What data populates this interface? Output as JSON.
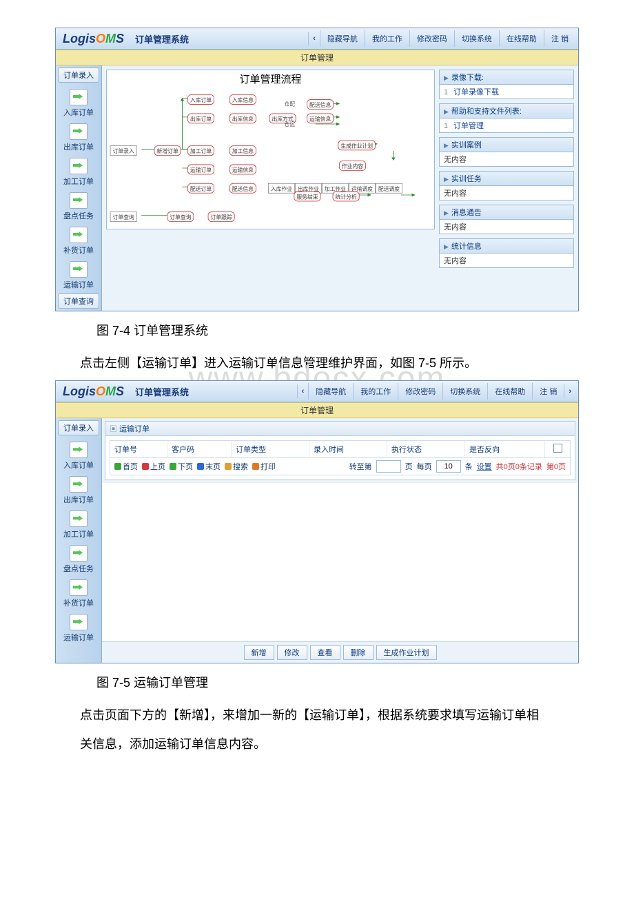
{
  "doc": {
    "caption1": "图 7-4 订单管理系统",
    "para1": "点击左侧【运输订单】进入运输订单信息管理维护界面，如图 7-5 所示。",
    "caption2": "图 7-5 运输订单管理",
    "para2": "点击页面下方的【新增】，来增加一新的【运输订单】，根据系统要求填写运输订单相",
    "para3": "关信息，添加运输订单信息内容。",
    "watermark": "www.bdocx.com"
  },
  "app": {
    "logo": {
      "p1": "Logis ",
      "p2": "O",
      "p3": "M",
      "p4": "S"
    },
    "system_title": "订单管理系统",
    "topnav": {
      "arrow_left": "‹",
      "hide_nav": "隐藏导航",
      "my_work": "我的工作",
      "change_pw": "修改密码",
      "switch_sys": "切换系统",
      "online_help": "在线帮助",
      "logout": "注    销",
      "arrow_right": "›"
    },
    "subbar": "订单管理",
    "sidebar": {
      "tab_input": "订单录入",
      "items": [
        "入库订单",
        "出库订单",
        "加工订单",
        "盘点任务",
        "补货订单",
        "运输订单"
      ],
      "tab_query": "订单查询"
    }
  },
  "flow": {
    "title": "订单管理流程",
    "order_input": "订单录入",
    "new_order": "新增订单",
    "in_order": "入库订单",
    "in_info": "入库信息",
    "out_order": "出库订单",
    "out_info": "出库信息",
    "out_way": "出库方式",
    "proc_order": "加工订单",
    "proc_info": "加工信息",
    "trans_order": "运输订单",
    "trans_info": "运输信息",
    "dist_order": "配送订单",
    "dist_info": "配送信息",
    "cang_pei": "仓配",
    "dist_route": "配送信息",
    "cang_yun": "仓运",
    "yun_info": "运输信息",
    "gen_plan": "生成作业计划",
    "job_content": "作业内容",
    "in_job": "入库作业",
    "out_job": "出库作业",
    "proc_job": "加工作业",
    "trans_sched": "运输调度",
    "dist_sched": "配送调度",
    "serv_end": "服务结束",
    "stat_analysis": "统计分析",
    "order_query_l": "订单查询",
    "order_query": "订单查询",
    "order_track": "订单跟踪"
  },
  "panels": {
    "download_h": "录像下载:",
    "download_1": "订单录像下载",
    "help_h": "帮助和支持文件列表:",
    "help_1": "订单管理",
    "case_h": "实训案例",
    "case_b": "无内容",
    "task_h": "实训任务",
    "task_b": "无内容",
    "notice_h": "消息通告",
    "notice_b": "无内容",
    "stat_h": "统计信息",
    "stat_b": "无内容"
  },
  "grid": {
    "title": "运输订单",
    "cols": {
      "c1": "订单号",
      "c2": "客户码",
      "c3": "订单类型",
      "c4": "录入时间",
      "c5": "执行状态",
      "c6": "是否反向"
    },
    "toolbar": {
      "first": "首页",
      "prev": "上页",
      "next": "下页",
      "last": "末页",
      "search": "搜索",
      "print": "打印",
      "goto_lbl": "转至第",
      "page_unit": "页",
      "perpage_lbl": "每页",
      "perpage_val": "10",
      "row_unit": "条",
      "setting": "设置",
      "summary": "共0页0条记录",
      "curpage": "第0页"
    },
    "footer": {
      "add": "新增",
      "edit": "修改",
      "view": "查看",
      "del": "删除",
      "gen": "生成作业计划"
    }
  }
}
